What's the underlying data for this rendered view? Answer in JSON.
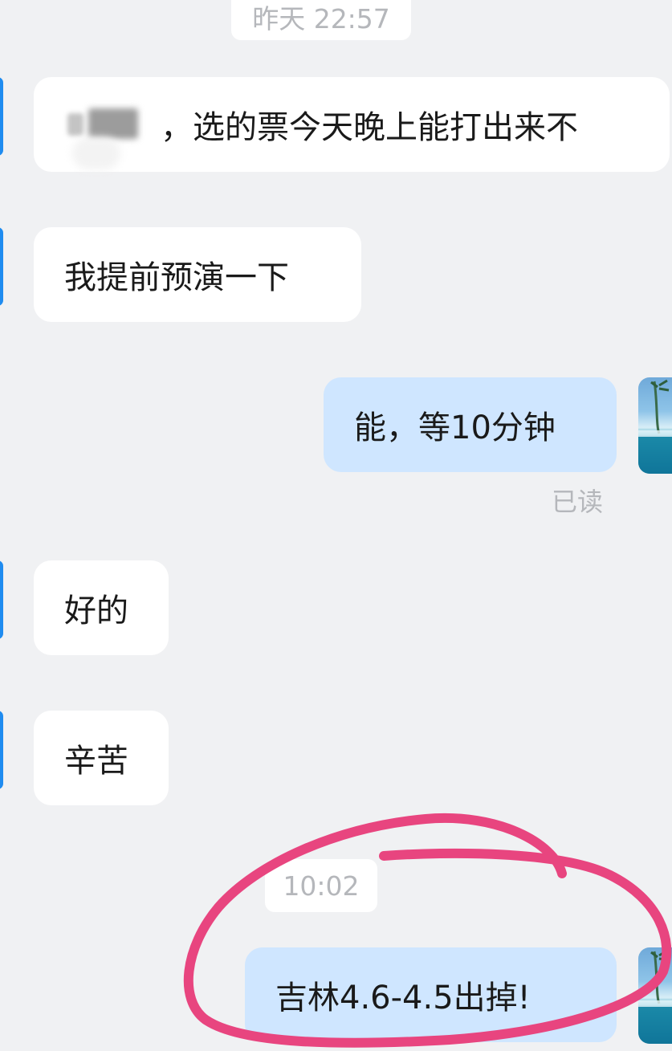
{
  "timestamps": {
    "top": "昨天 22:57",
    "middle": "10:02"
  },
  "messages": [
    {
      "direction": "incoming",
      "text": "，选的票今天晚上能打出来不",
      "sender_name_blurred": true
    },
    {
      "direction": "incoming",
      "text": "我提前预演一下"
    },
    {
      "direction": "outgoing",
      "text": "能，等10分钟"
    },
    {
      "direction": "incoming",
      "text": "好的"
    },
    {
      "direction": "incoming",
      "text": "辛苦"
    },
    {
      "direction": "outgoing",
      "text": "吉林4.6-4.5出掉!"
    }
  ],
  "read_status": "已读",
  "colors": {
    "background": "#f0f1f3",
    "incoming_bubble": "#ffffff",
    "outgoing_bubble": "#cfe6ff",
    "annotation_circle": "#e8457f",
    "avatar_accent": "#1f8cf0"
  },
  "icons": {
    "incoming_avatar": "contact-avatar",
    "my_avatar": "sea-landscape-avatar"
  }
}
